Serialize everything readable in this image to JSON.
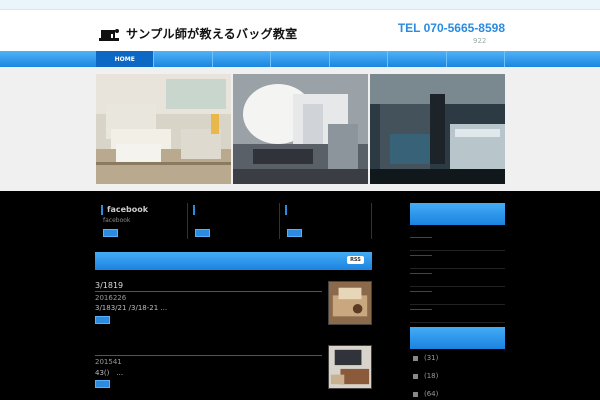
{
  "header": {
    "site_title": "サンプル師が教えるバッグ教室",
    "tel": "TEL 070-5665-8598",
    "tel_sub": "922"
  },
  "nav": {
    "items": [
      {
        "label": "HOME",
        "active": true
      },
      {
        "label": ""
      },
      {
        "label": ""
      },
      {
        "label": ""
      },
      {
        "label": ""
      },
      {
        "label": ""
      },
      {
        "label": ""
      }
    ]
  },
  "social": [
    {
      "title": "facebook",
      "subtitle": "facebook"
    },
    {
      "title": "",
      "subtitle": ""
    },
    {
      "title": "",
      "subtitle": ""
    }
  ],
  "section": {
    "rss_label": "RSS"
  },
  "posts": [
    {
      "title": "3/1819",
      "date": "2016226",
      "excerpt": "3/183/21 /3/18-21 ..."
    },
    {
      "title": "",
      "date": "201541",
      "excerpt": "43()　..."
    }
  ],
  "sidebar": {
    "categories": [
      {
        "count": "(31)"
      },
      {
        "count": "(18)"
      },
      {
        "count": "(64)"
      }
    ]
  },
  "colors": {
    "accent": "#2a8be0",
    "nav_active": "#0c68c4"
  }
}
